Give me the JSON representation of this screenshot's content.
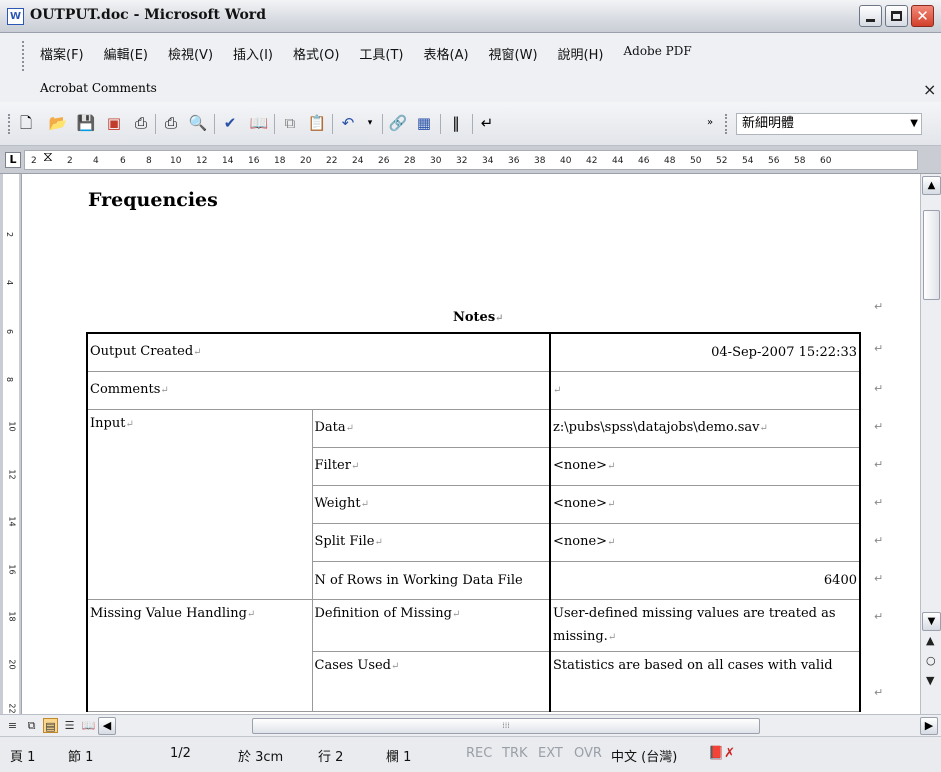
{
  "window": {
    "title": "OUTPUT.doc - Microsoft Word",
    "app_icon": "W"
  },
  "menu": {
    "items": [
      "檔案(F)",
      "編輯(E)",
      "檢視(V)",
      "插入(I)",
      "格式(O)",
      "工具(T)",
      "表格(A)",
      "視窗(W)",
      "說明(H)",
      "Adobe PDF"
    ],
    "row2": "Acrobat Comments",
    "close_glyph": "×"
  },
  "toolbar": {
    "font_name": "新細明體"
  },
  "ruler": {
    "left_num": "2",
    "numbers": [
      "2",
      "4",
      "6",
      "8",
      "10",
      "12",
      "14",
      "16",
      "18",
      "20",
      "22",
      "24",
      "26",
      "28",
      "30",
      "32",
      "34",
      "36",
      "38",
      "40",
      "42",
      "44",
      "46",
      "48",
      "50",
      "52",
      "54",
      "56",
      "58",
      "60"
    ],
    "vertical_numbers": [
      "2",
      "4",
      "6",
      "8",
      "10",
      "12",
      "14",
      "16",
      "18",
      "20",
      "22"
    ]
  },
  "document": {
    "heading": "Frequencies",
    "table_caption": "Notes",
    "rows": [
      {
        "c1": "Output Created",
        "c2": "",
        "c3": "04-Sep-2007 15:22:33"
      },
      {
        "c1": "Comments",
        "c2": "",
        "c3": ""
      },
      {
        "c1": "Input",
        "c2": "Data",
        "c3": "z:\\pubs\\spss\\datajobs\\demo.sav"
      },
      {
        "c1": "",
        "c2": "Filter",
        "c3": "<none>"
      },
      {
        "c1": "",
        "c2": "Weight",
        "c3": "<none>"
      },
      {
        "c1": "",
        "c2": "Split File",
        "c3": "<none>"
      },
      {
        "c1": "",
        "c2": "N of Rows in Working Data File",
        "c3": "6400"
      },
      {
        "c1": "Missing Value Handling",
        "c2": "Definition of Missing",
        "c3": "User-defined missing values are treated as missing."
      },
      {
        "c1": "",
        "c2": "Cases Used",
        "c3": "Statistics are based on all cases with valid"
      }
    ]
  },
  "status": {
    "page": "頁 1",
    "section": "節 1",
    "page_of": "1/2",
    "at": "於 3cm",
    "line": "行 2",
    "col": "欄 1",
    "rec": "REC",
    "trk": "TRK",
    "ext": "EXT",
    "ovr": "OVR",
    "language": "中文 (台灣)"
  }
}
